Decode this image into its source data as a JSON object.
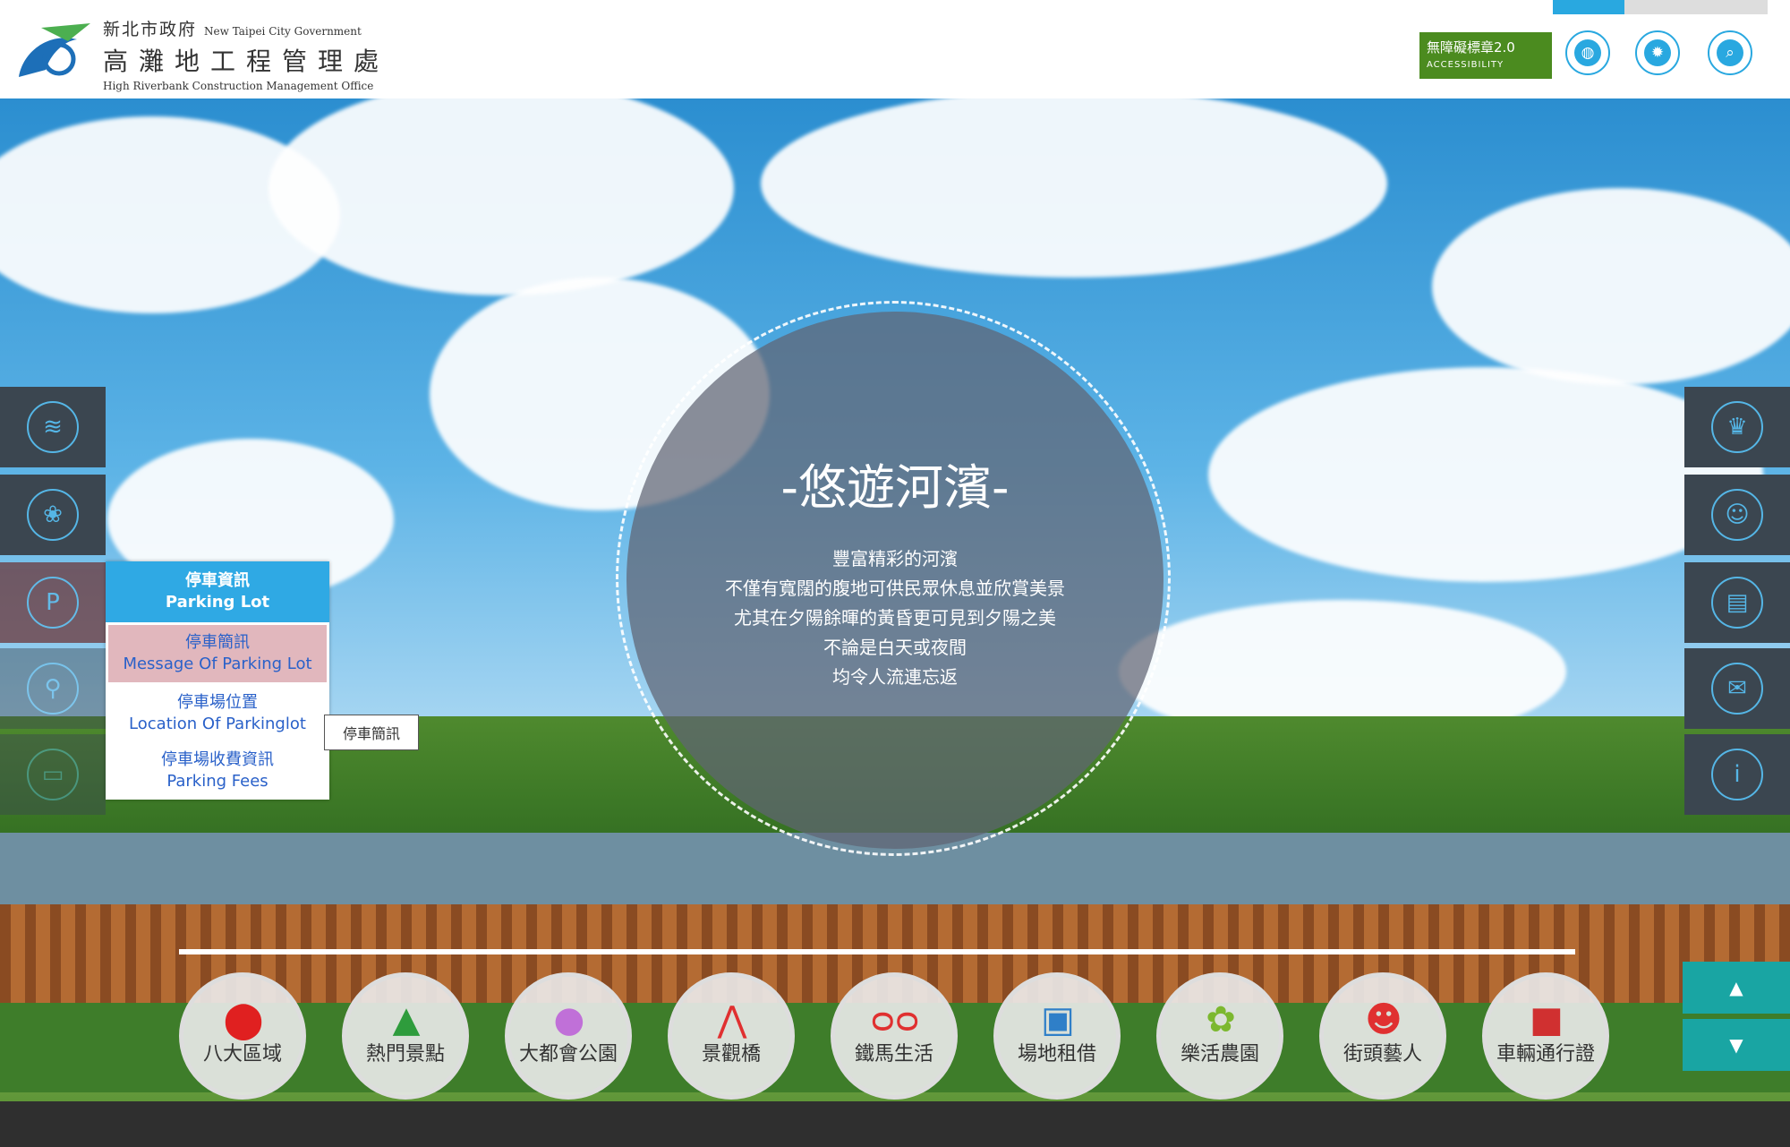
{
  "header": {
    "org_zh": "新北市政府",
    "org_en": "New Taipei City Government",
    "office_zh": "高灘地工程管理處",
    "office_en": "High Riverbank Construction Management Office",
    "accessibility_badge": "無障礙標章2.0",
    "accessibility_text": "ACCESSIBILITY",
    "buttons": [
      "globe-icon",
      "gear-icon",
      "search-icon"
    ]
  },
  "hero": {
    "title": "-悠遊河濱-",
    "lines": [
      "豐富精彩的河濱",
      "不僅有寬闊的腹地可供民眾休息並欣賞美景",
      "尤其在夕陽餘暉的黃昏更可見到夕陽之美",
      "不論是白天或夜間",
      "均令人流連忘返"
    ]
  },
  "left_nav": [
    "wave-icon",
    "flower-icon",
    "parking-icon",
    "location-pin-icon",
    "book-icon"
  ],
  "left_nav_parking_glyph": "P",
  "right_nav": [
    "trophy-icon",
    "group-icon",
    "newspaper-icon",
    "mail-icon",
    "info-icon"
  ],
  "parking_menu": {
    "head_zh": "停車資訊",
    "head_en": "Parking Lot",
    "items": [
      {
        "zh": "停車簡訊",
        "en": "Message Of Parking Lot"
      },
      {
        "zh": "停車場位置",
        "en": "Location Of Parkinglot"
      },
      {
        "zh": "停車場收費資訊",
        "en": "Parking Fees"
      }
    ],
    "tooltip": "停車簡訊"
  },
  "wheels": [
    "八大區域",
    "熱門景點",
    "大都會公園",
    "景觀橋",
    "鐵馬生活",
    "場地租借",
    "樂活農園",
    "街頭藝人",
    "車輛通行證"
  ],
  "scroll": {
    "up": "▲",
    "down": "▼"
  },
  "colors": {
    "accent": "#29a8e0",
    "teal": "#19a5a3",
    "menu_head": "#2fa9e4",
    "menu_active": "#e1b7bd"
  }
}
